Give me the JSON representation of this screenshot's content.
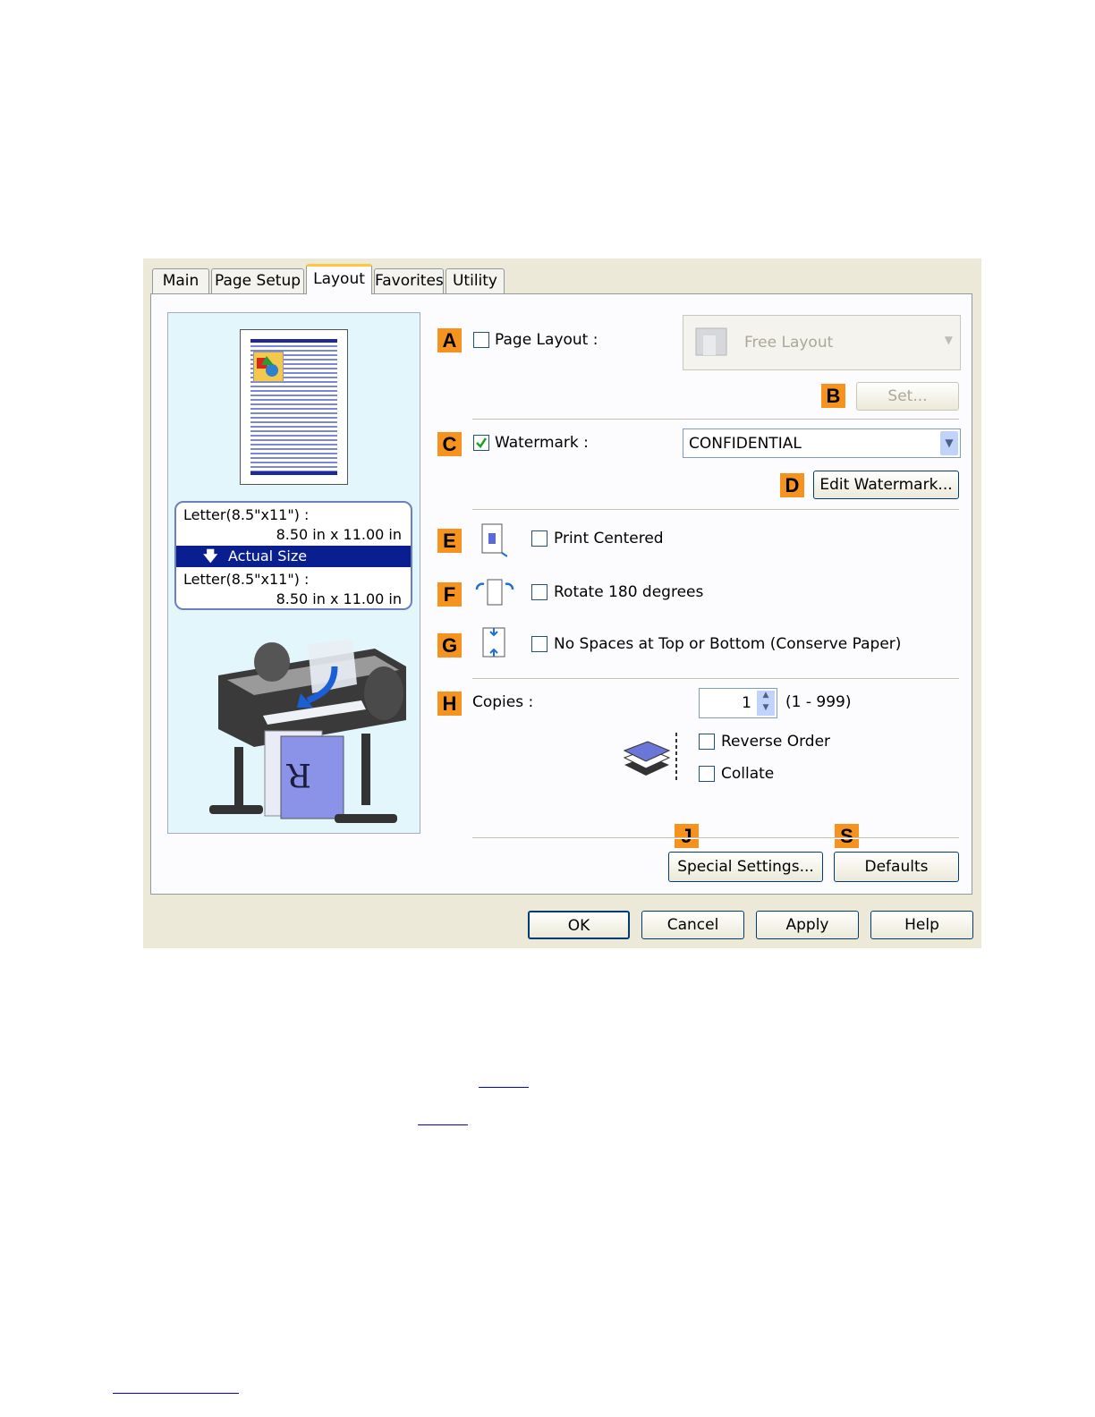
{
  "tabs": [
    {
      "label": "Main"
    },
    {
      "label": "Page Setup"
    },
    {
      "label": "Layout"
    },
    {
      "label": "Favorites"
    },
    {
      "label": "Utility"
    }
  ],
  "active_tab": "Layout",
  "preview": {
    "source_size": "Letter(8.5\"x11\") :",
    "source_dims": "8.50 in x 11.00 in",
    "scaling": "Actual Size",
    "output_size": "Letter(8.5\"x11\") :",
    "output_dims": "8.50 in x 11.00 in"
  },
  "badges": {
    "a": "A",
    "b": "B",
    "c": "C",
    "d": "D",
    "e": "E",
    "f": "F",
    "g": "G",
    "h": "H",
    "j": "J",
    "s": "S"
  },
  "page_layout": {
    "label": "Page Layout :",
    "checked": false,
    "value": "Free Layout",
    "set_button": "Set..."
  },
  "watermark": {
    "label": "Watermark :",
    "checked": true,
    "value": "CONFIDENTIAL",
    "edit_button": "Edit Watermark..."
  },
  "print_centered": {
    "label": "Print Centered",
    "checked": false
  },
  "rotate": {
    "label": "Rotate 180 degrees",
    "checked": false
  },
  "no_spaces": {
    "label": "No Spaces at Top or Bottom (Conserve Paper)",
    "checked": false
  },
  "copies": {
    "label": "Copies :",
    "value": "1",
    "range": "(1 - 999)"
  },
  "reverse_order": {
    "label": "Reverse Order",
    "checked": false
  },
  "collate": {
    "label": "Collate",
    "checked": false
  },
  "special_settings_button": "Special Settings...",
  "defaults_button": "Defaults",
  "footer": {
    "ok": "OK",
    "cancel": "Cancel",
    "apply": "Apply",
    "help": "Help"
  },
  "colors": {
    "badge": "#f5931e",
    "selection": "#0a1f8f",
    "dialog_bg": "#ece9d8"
  }
}
